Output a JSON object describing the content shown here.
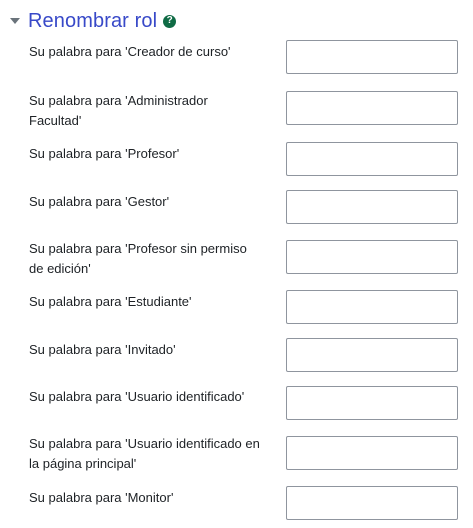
{
  "section": {
    "title": "Renombrar rol",
    "help_icon_glyph": "?",
    "collapse_icon": "caret-down-icon",
    "help_icon": "question-circle-icon",
    "title_color": "#3849c8",
    "help_color": "#0f6b45"
  },
  "fields": [
    {
      "label": "Su palabra para 'Creador de curso'",
      "value": ""
    },
    {
      "label": "Su palabra para 'Administrador Facultad'",
      "value": ""
    },
    {
      "label": "Su palabra para 'Profesor'",
      "value": ""
    },
    {
      "label": "Su palabra para 'Gestor'",
      "value": ""
    },
    {
      "label": "Su palabra para 'Profesor sin permiso de edición'",
      "value": ""
    },
    {
      "label": "Su palabra para 'Estudiante'",
      "value": ""
    },
    {
      "label": "Su palabra para 'Invitado'",
      "value": ""
    },
    {
      "label": "Su palabra para 'Usuario identificado'",
      "value": ""
    },
    {
      "label": "Su palabra para 'Usuario identificado en la página principal'",
      "value": ""
    },
    {
      "label": "Su palabra para 'Monitor'",
      "value": ""
    }
  ]
}
